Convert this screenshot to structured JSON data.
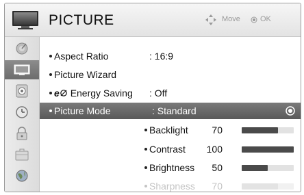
{
  "header": {
    "title": "PICTURE",
    "hint_move": "Move",
    "hint_ok": "OK",
    "icon": "tv-screen-icon"
  },
  "sidebar": {
    "items": [
      {
        "icon": "satellite-dish-icon",
        "active": false
      },
      {
        "icon": "tv-screen-icon",
        "active": true
      },
      {
        "icon": "speaker-icon",
        "active": false
      },
      {
        "icon": "clock-icon",
        "active": false
      },
      {
        "icon": "lock-icon",
        "active": false
      },
      {
        "icon": "briefcase-icon",
        "active": false
      },
      {
        "icon": "globe-icon",
        "active": false
      }
    ]
  },
  "menu": {
    "items": [
      {
        "label": "Aspect Ratio",
        "value": ": 16:9"
      },
      {
        "label": "Picture Wizard",
        "value": ""
      },
      {
        "label": "Energy Saving",
        "prefix": "e",
        "value": ": Off"
      },
      {
        "label": "Picture Mode",
        "value": ": Standard",
        "selected": true
      }
    ]
  },
  "settings": [
    {
      "label": "Backlight",
      "value": "70",
      "level": 70,
      "enabled": true
    },
    {
      "label": "Contrast",
      "value": "100",
      "level": 100,
      "enabled": true
    },
    {
      "label": "Brightness",
      "value": "50",
      "level": 50,
      "enabled": true
    },
    {
      "label": "Sharpness",
      "value": "70",
      "level": 70,
      "enabled": false
    }
  ],
  "colors": {
    "selected_row": "#6a6a6a",
    "bar_fill": "#4a4a4a",
    "bar_track": "#e2e2e2",
    "disabled_text": "#c4c4c4"
  }
}
